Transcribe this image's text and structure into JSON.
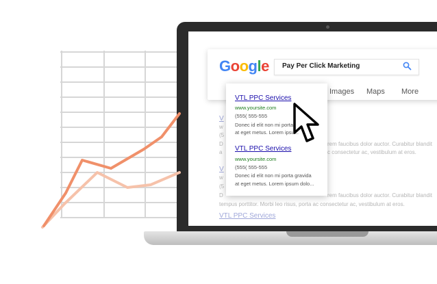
{
  "colors": {
    "grid": "#d6d6d6",
    "trend_primary": "#f0906a",
    "trend_secondary": "#f6c2aa",
    "google_blue": "#4285F4",
    "google_red": "#EA4335",
    "google_yellow": "#FBBC05",
    "google_green": "#34A853",
    "ad_link": "#1a0dab",
    "ad_url": "#1b7a1b"
  },
  "google": {
    "logo_letters": [
      "G",
      "o",
      "o",
      "g",
      "l",
      "e"
    ],
    "search_query": "Pay Per Click Marketing",
    "icon": "search-icon"
  },
  "nav_tabs": [
    "Images",
    "Maps",
    "More"
  ],
  "ad_results": [
    {
      "title": "VTL PPC Services",
      "url": "www.yoursite.com",
      "phone": "(555( 555-555",
      "desc_line1": "Donec id elit non mi porta",
      "desc_line2": "at eget metus. Lorem ipsu..."
    },
    {
      "title": "VTL PPC Services",
      "url": "www.yoursite.com",
      "phone": "(555( 555-555",
      "desc_line1": "Donec id elit non mi porta gravida",
      "desc_line2": "at eget metus. Lorem ipsum dolo..."
    }
  ],
  "background_results": {
    "row1_tail1": "rem faucibus dolor auctor. Curabitur blandit",
    "row1_tail2": "c consectetur ac, vestibulum at eros.",
    "row2_tail1": "rem faucibus dolor auctor. Curabitur blandit",
    "row2_tail2": "c consectetur ac, vestibulum at eros.",
    "bottom_text": "tempus porttitor. Morbi leo risus, porta ac consectetur ac, vestibulum at eros.",
    "bottom_link": "VTL PPC Services",
    "left_frag_v": "V",
    "left_frag_w": "w",
    "left_frag_paren": "(5",
    "left_frag_d": "D",
    "left_frag_a": "a"
  },
  "cursor_icon": "arrow-cursor-icon"
}
